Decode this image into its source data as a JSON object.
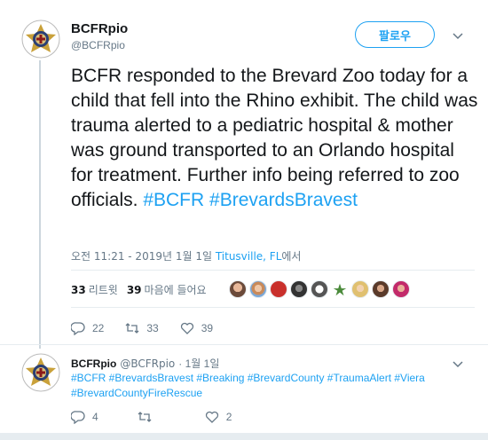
{
  "main_tweet": {
    "display_name": "BCFRpio",
    "handle": "@BCFRpio",
    "follow_label": "팔로우",
    "text_plain": "BCFR responded to the Brevard Zoo today for a child that fell into the Rhino exhibit. The child was trauma alerted to a pediatric hospital & mother was ground transported to an Orlando hospital for treatment. Further info being referred to zoo officials.",
    "hashtags": [
      "#BCFR",
      "#BrevardsBravest"
    ],
    "timestamp": "오전 11:21 - 2019년 1월 1일",
    "location": "Titusville, FL",
    "location_suffix": "에서",
    "retweets_count": "33",
    "retweets_label": "리트윗",
    "likes_count": "39",
    "likes_label": "마음에 들어요",
    "replies": "22",
    "retweets": "33",
    "likes": "39"
  },
  "reply_tweet": {
    "display_name": "BCFRpio",
    "handle": "@BCFRpio",
    "date": "· 1월 1일",
    "text": "#BCFR #BrevardsBravest #Breaking #BrevardCounty #TraumaAlert #Viera #BrevardCountyFireRescue",
    "replies": "4",
    "retweets": "",
    "likes": "2"
  },
  "icons": {
    "avatar": "bcfr-badge-avatar",
    "chevron": "chevron-down-icon",
    "reply": "reply-icon",
    "retweet": "retweet-icon",
    "like": "heart-icon"
  },
  "colors": {
    "accent": "#1da1f2",
    "text": "#14171a",
    "muted": "#657786",
    "divider": "#e6ecf0"
  }
}
